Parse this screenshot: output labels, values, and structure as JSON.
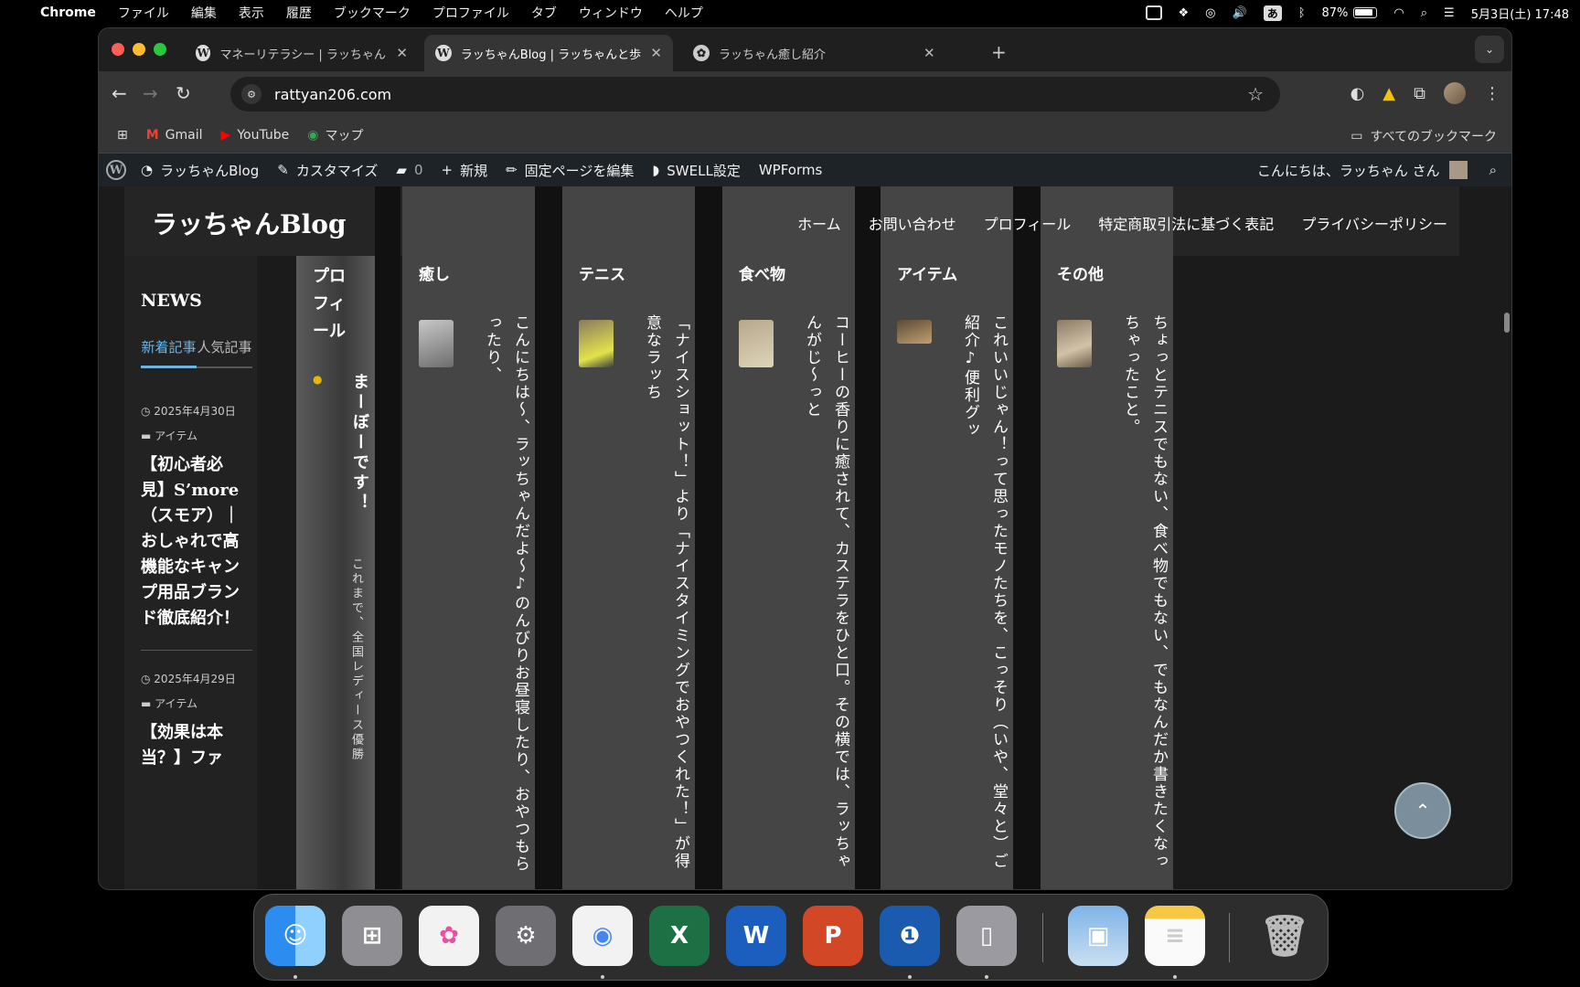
{
  "menubar": {
    "app": "Chrome",
    "items": [
      "ファイル",
      "編集",
      "表示",
      "履歴",
      "ブックマーク",
      "プロファイル",
      "タブ",
      "ウィンドウ",
      "ヘルプ"
    ],
    "battery": "87%",
    "battery_level": 0.87,
    "ime": "あ",
    "datetime": "5月3日(土) 17:48"
  },
  "browser": {
    "tabs": [
      {
        "title": "マネーリテラシー | ラッちゃんBl",
        "icon": "wordpress-icon",
        "active": false
      },
      {
        "title": "ラッちゃんBlog | ラッちゃんと歩",
        "icon": "wordpress-icon",
        "active": true
      },
      {
        "title": "ラッちゃん癒し紹介",
        "icon": "chatgpt-icon",
        "active": false
      }
    ],
    "url": "rattyan206.com",
    "bookmarks": [
      "Gmail",
      "YouTube",
      "マップ"
    ],
    "all_bookmarks": "すべてのブックマーク"
  },
  "wpbar": {
    "site": "ラッちゃんBlog",
    "customize": "カスタマイズ",
    "comments": "0",
    "new": "新規",
    "edit_page": "固定ページを編集",
    "swell": "SWELL設定",
    "wpforms": "WPForms",
    "greeting": "こんにちは、ラッちゃん さん"
  },
  "site": {
    "logo": "ラッちゃんBlog",
    "nav": [
      "ホーム",
      "お問い合わせ",
      "プロフィール",
      "特定商取引法に基づく表記",
      "プライバシーポリシー"
    ]
  },
  "sidebar": {
    "heading": "NEWS",
    "tabs": [
      "新着記事",
      "人気記事"
    ],
    "posts": [
      {
        "date": "2025年4月30日",
        "category": "アイテム",
        "title": "【初心者必見】S’more（スモア）｜おしゃれで高機能なキャンプ用品ブランド徹底紹介！"
      },
      {
        "date": "2025年4月29日",
        "category": "アイテム",
        "title": "【効果は本当？】ファ"
      }
    ]
  },
  "profile": {
    "heading": "プロフィール",
    "name": "まーぼーです！",
    "desc": "これまで、全国レディース優勝"
  },
  "columns": [
    {
      "heading": "癒し",
      "text": "こんにちは〜、ラッちゃんだよ〜♪のんびりお昼寝したり、おやつもらったり、"
    },
    {
      "heading": "テニス",
      "text": "「ナイスショット！」より「ナイスタイミングでおやつくれた！」が得意なラッち"
    },
    {
      "heading": "食べ物",
      "text": "コーヒーの香りに癒されて、カステラをひと口。その横では、ラッちゃんがじ〜っと"
    },
    {
      "heading": "アイテム",
      "text": "これいいじゃん！って思ったモノたちを、こっそり（いや、堂々と）ご紹介♪便利グッ"
    },
    {
      "heading": "その他",
      "text": "ちょっとテニスでもない、食べ物でもない、でもなんだか書きたくなっちゃったこと。"
    }
  ],
  "dock": [
    "Finder",
    "Launchpad",
    "Photos",
    "System Settings",
    "Chrome",
    "Excel",
    "Word",
    "PowerPoint",
    "1Password",
    "iPhone Mirroring",
    "Preview",
    "Notes",
    "Trash"
  ]
}
